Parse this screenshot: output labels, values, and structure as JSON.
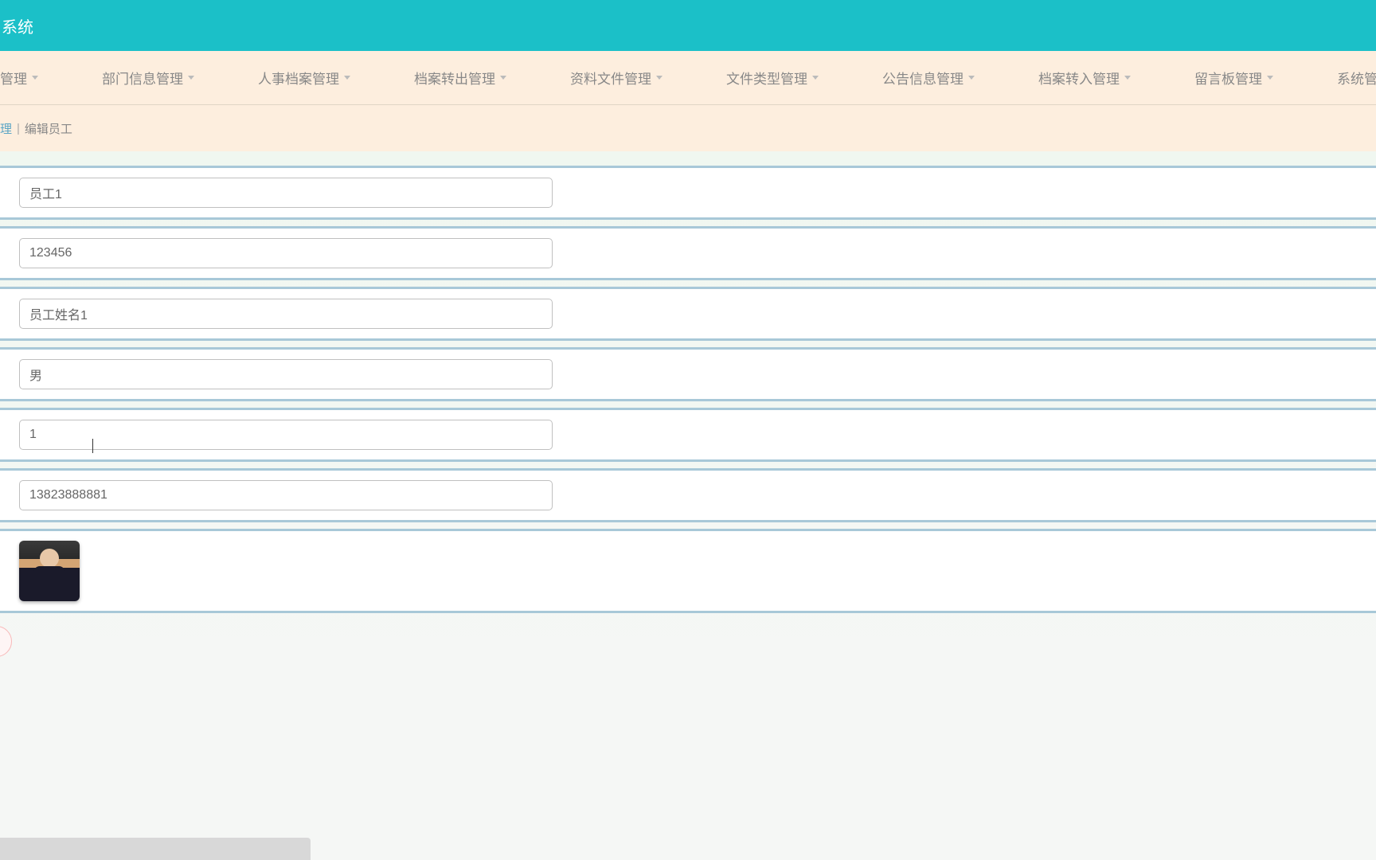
{
  "header": {
    "title": "系统"
  },
  "nav": {
    "items": [
      {
        "label": "管理"
      },
      {
        "label": "部门信息管理"
      },
      {
        "label": "人事档案管理"
      },
      {
        "label": "档案转出管理"
      },
      {
        "label": "资料文件管理"
      },
      {
        "label": "文件类型管理"
      },
      {
        "label": "公告信息管理"
      },
      {
        "label": "档案转入管理"
      },
      {
        "label": "留言板管理"
      },
      {
        "label": "系统管理"
      }
    ]
  },
  "breadcrumb": {
    "link": "理",
    "current": "编辑员工"
  },
  "form": {
    "fields": [
      {
        "value": "员工1"
      },
      {
        "value": "123456"
      },
      {
        "value": "员工姓名1"
      },
      {
        "value": "男"
      },
      {
        "value": "1"
      },
      {
        "value": "13823888881"
      }
    ]
  },
  "button": {
    "submit_fragment": "]"
  }
}
